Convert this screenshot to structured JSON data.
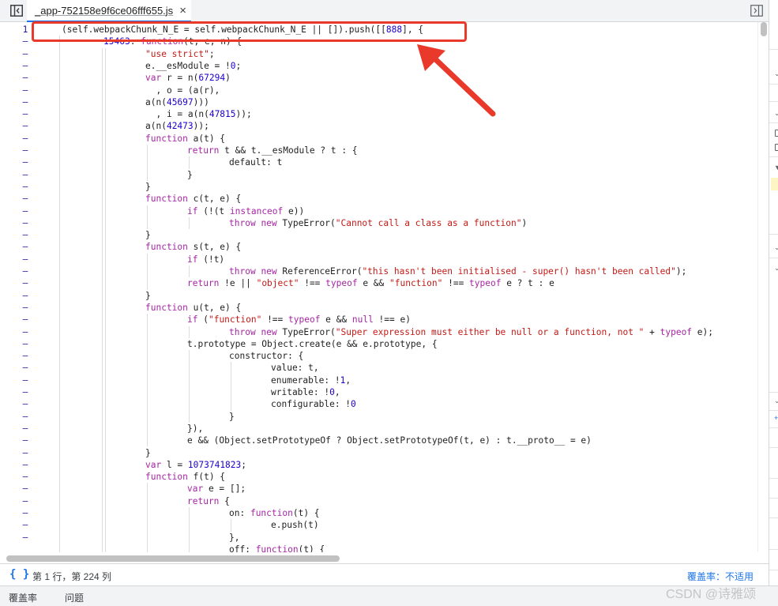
{
  "tab": {
    "filename": "_app-752158e9f6ce06fff655.js",
    "close_glyph": "×"
  },
  "code_lines": [
    {
      "ln": "1",
      "indent": 0,
      "html": "(self.webpackChunk_N_E = self.webpackChunk_N_E || []).push([[<span class=\"num\">888</span>], {"
    },
    {
      "ln": "–",
      "indent": 1,
      "html": "<span class=\"num\">15463</span>: <span class=\"kw\">function</span>(t, e, n) {"
    },
    {
      "ln": "–",
      "indent": 2,
      "html": "<span class=\"str\">\"use strict\"</span>;"
    },
    {
      "ln": "–",
      "indent": 2,
      "html": "e.__esModule = !<span class=\"num\">0</span>;"
    },
    {
      "ln": "–",
      "indent": 2,
      "html": "<span class=\"kw\">var</span> r = n(<span class=\"num\">67294</span>)"
    },
    {
      "ln": "–",
      "indent": 2,
      "html": "  , o = (a(r),"
    },
    {
      "ln": "–",
      "indent": 2,
      "html": "a(n(<span class=\"num\">45697</span>)))"
    },
    {
      "ln": "–",
      "indent": 2,
      "html": "  , i = a(n(<span class=\"num\">47815</span>));"
    },
    {
      "ln": "–",
      "indent": 2,
      "html": "a(n(<span class=\"num\">42473</span>));"
    },
    {
      "ln": "–",
      "indent": 2,
      "html": "<span class=\"kw\">function</span> a(t) {"
    },
    {
      "ln": "–",
      "indent": 3,
      "html": "<span class=\"kw\">return</span> t && t.__esModule ? t : {"
    },
    {
      "ln": "–",
      "indent": 4,
      "html": "default: t"
    },
    {
      "ln": "–",
      "indent": 3,
      "html": "}"
    },
    {
      "ln": "–",
      "indent": 2,
      "html": "}"
    },
    {
      "ln": "–",
      "indent": 2,
      "html": "<span class=\"kw\">function</span> c(t, e) {"
    },
    {
      "ln": "–",
      "indent": 3,
      "html": "<span class=\"kw\">if</span> (!(t <span class=\"kw\">instanceof</span> e))"
    },
    {
      "ln": "–",
      "indent": 4,
      "html": "<span class=\"kw\">throw</span> <span class=\"kw\">new</span> TypeError(<span class=\"str\">\"Cannot call a class as a function\"</span>)"
    },
    {
      "ln": "–",
      "indent": 2,
      "html": "}"
    },
    {
      "ln": "–",
      "indent": 2,
      "html": "<span class=\"kw\">function</span> s(t, e) {"
    },
    {
      "ln": "–",
      "indent": 3,
      "html": "<span class=\"kw\">if</span> (!t)"
    },
    {
      "ln": "–",
      "indent": 4,
      "html": "<span class=\"kw\">throw</span> <span class=\"kw\">new</span> ReferenceError(<span class=\"str\">\"this hasn't been initialised - super() hasn't been called\"</span>);"
    },
    {
      "ln": "–",
      "indent": 3,
      "html": "<span class=\"kw\">return</span> !e || <span class=\"str\">\"object\"</span> !== <span class=\"kw\">typeof</span> e && <span class=\"str\">\"function\"</span> !== <span class=\"kw\">typeof</span> e ? t : e"
    },
    {
      "ln": "–",
      "indent": 2,
      "html": "}"
    },
    {
      "ln": "–",
      "indent": 2,
      "html": "<span class=\"kw\">function</span> u(t, e) {"
    },
    {
      "ln": "–",
      "indent": 3,
      "html": "<span class=\"kw\">if</span> (<span class=\"str\">\"function\"</span> !== <span class=\"kw\">typeof</span> e && <span class=\"kw\">null</span> !== e)"
    },
    {
      "ln": "–",
      "indent": 4,
      "html": "<span class=\"kw\">throw</span> <span class=\"kw\">new</span> TypeError(<span class=\"str\">\"Super expression must either be null or a function, not \"</span> + <span class=\"kw\">typeof</span> e);"
    },
    {
      "ln": "–",
      "indent": 3,
      "html": "t.prototype = Object.create(e && e.prototype, {"
    },
    {
      "ln": "–",
      "indent": 4,
      "html": "constructor: {"
    },
    {
      "ln": "–",
      "indent": 5,
      "html": "value: t,"
    },
    {
      "ln": "–",
      "indent": 5,
      "html": "enumerable: !<span class=\"num\">1</span>,"
    },
    {
      "ln": "–",
      "indent": 5,
      "html": "writable: !<span class=\"num\">0</span>,"
    },
    {
      "ln": "–",
      "indent": 5,
      "html": "configurable: !<span class=\"num\">0</span>"
    },
    {
      "ln": "–",
      "indent": 4,
      "html": "}"
    },
    {
      "ln": "–",
      "indent": 3,
      "html": "}),"
    },
    {
      "ln": "–",
      "indent": 3,
      "html": "e && (Object.setPrototypeOf ? Object.setPrototypeOf(t, e) : t.__proto__ = e)"
    },
    {
      "ln": "–",
      "indent": 2,
      "html": "}"
    },
    {
      "ln": "–",
      "indent": 2,
      "html": "<span class=\"kw\">var</span> l = <span class=\"num\">1073741823</span>;"
    },
    {
      "ln": "–",
      "indent": 2,
      "html": "<span class=\"kw\">function</span> f(t) {"
    },
    {
      "ln": "–",
      "indent": 3,
      "html": "<span class=\"kw\">var</span> e = [];"
    },
    {
      "ln": "–",
      "indent": 3,
      "html": "<span class=\"kw\">return</span> {"
    },
    {
      "ln": "–",
      "indent": 4,
      "html": "on: <span class=\"kw\">function</span>(t) {"
    },
    {
      "ln": "–",
      "indent": 5,
      "html": "e.push(t)"
    },
    {
      "ln": "–",
      "indent": 4,
      "html": "},"
    },
    {
      "ln": "",
      "indent": 4,
      "html": "off: <span class=\"kw\">function</span>(t) {"
    }
  ],
  "status": {
    "braces_icon": "{ }",
    "cursor_position": "第 1 行，第 224 列",
    "coverage_label": "覆盖率：不适用"
  },
  "drawer": {
    "tabs": [
      "覆盖率",
      "问题"
    ]
  },
  "watermark": "CSDN @诗雅颂",
  "colors": {
    "accent": "#1a73e8",
    "highlight_box": "#e8392a",
    "keyword": "#a626a4",
    "string": "#c41a16",
    "number": "#1c00cf"
  }
}
